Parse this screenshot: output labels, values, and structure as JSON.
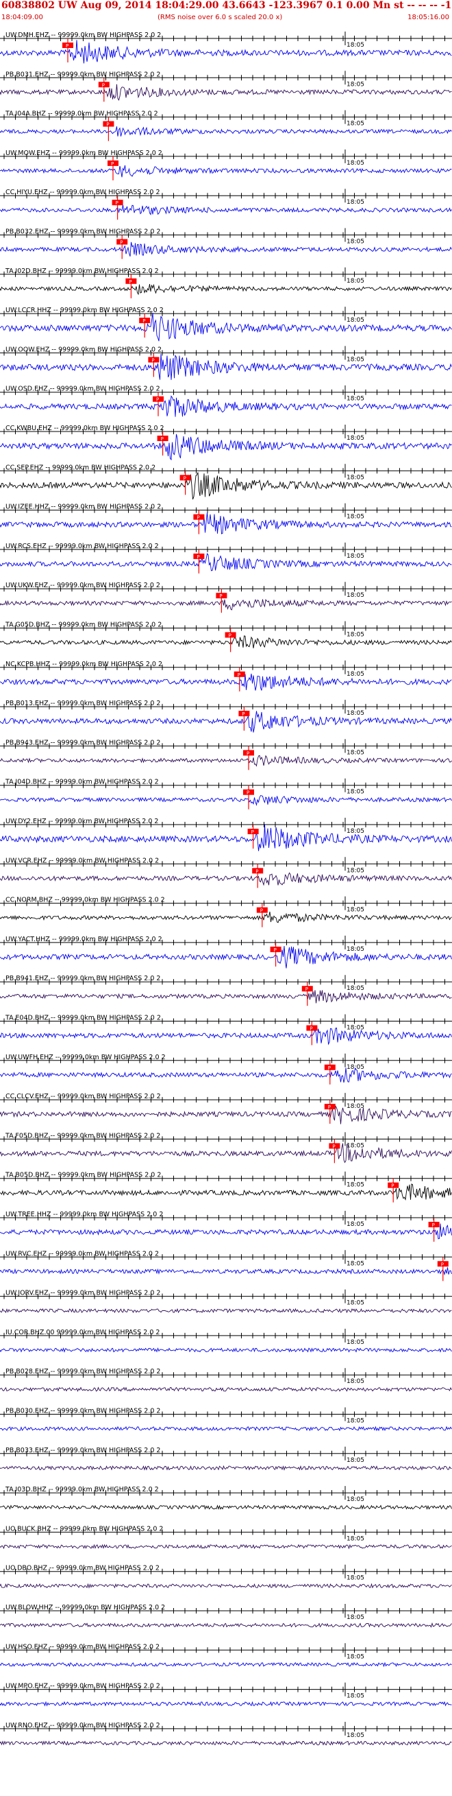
{
  "header": {
    "title": "60838802 UW Aug 09, 2014 18:04:29.00   43.6643 -123.3967  0.1 0.00 Mn st -- -- --  -1",
    "time_start": "18:04:09.00",
    "note": "(RMS noise over 6.0 s scaled 20.0 x)",
    "time_end": "18:05:16.00"
  },
  "minute_label": "18:05",
  "pick_label": "P",
  "colors": {
    "header": "#d00000",
    "pick": "#ff0000",
    "blue": "#0000ee",
    "black": "#000000",
    "purple": "#2a0a55",
    "axis": "#000000"
  },
  "traces": [
    {
      "label": "UW.DMH.EHZ -- 99999.0km BW  HIGHPASS  2.0  2",
      "color": "blue",
      "pick": 0.15,
      "amp": 0.8
    },
    {
      "label": "PB.B031.EHZ -- 99999.0km BW  HIGHPASS  2.0  2",
      "color": "purple",
      "pick": 0.23,
      "amp": 0.5
    },
    {
      "label": "TA.I04A.BHZ -- 99999.0km BW  HIGHPASS  2.0  2",
      "color": "blue",
      "pick": 0.24,
      "amp": 0.3
    },
    {
      "label": "UW.MOW.EHZ -- 99999.0km BW  HIGHPASS  2.0  2",
      "color": "blue",
      "pick": 0.25,
      "amp": 0.35
    },
    {
      "label": "CC.HIYU.EHZ -- 99999.0km BW  HIGHPASS  2.0  2",
      "color": "blue",
      "pick": 0.26,
      "amp": 0.35
    },
    {
      "label": "PB.B032.EHZ -- 99999.0km BW  HIGHPASS  2.0  2",
      "color": "blue",
      "pick": 0.27,
      "amp": 0.4
    },
    {
      "label": "TA.I02D.BHZ -- 99999.0km BW  HIGHPASS  2.0  2",
      "color": "black",
      "pick": 0.29,
      "amp": 0.3
    },
    {
      "label": "UW.LCCR.HHZ -- 99999.0km BW  HIGHPASS  2.0  2",
      "color": "blue",
      "pick": 0.32,
      "amp": 1.0
    },
    {
      "label": "UW.OOW.EHZ -- 99999.0km BW  HIGHPASS  2.0  2",
      "color": "blue",
      "pick": 0.34,
      "amp": 1.0
    },
    {
      "label": "UW.OSD.EHZ -- 99999.0km BW  HIGHPASS  2.0  2",
      "color": "blue",
      "pick": 0.35,
      "amp": 0.8
    },
    {
      "label": "CC.KWBU.EHZ -- 99999.0km BW  HIGHPASS  2.0  2",
      "color": "blue",
      "pick": 0.36,
      "amp": 0.9
    },
    {
      "label": "CC.SEP.EHZ -- 99999.0km BW  HIGHPASS  2.0  2",
      "color": "black",
      "pick": 0.41,
      "amp": 0.9
    },
    {
      "label": "UW.IZEE.HHZ -- 99999.0km BW  HIGHPASS  2.0  2",
      "color": "blue",
      "pick": 0.44,
      "amp": 0.7
    },
    {
      "label": "UW.RCS.EHZ -- 99999.0km BW  HIGHPASS  2.0  2",
      "color": "blue",
      "pick": 0.44,
      "amp": 0.6
    },
    {
      "label": "UW.UKW.EHZ -- 99999.0km BW  HIGHPASS  2.0  2",
      "color": "purple",
      "pick": 0.49,
      "amp": 0.4
    },
    {
      "label": "TA.G05D.BHZ -- 99999.0km BW  HIGHPASS  2.0  2",
      "color": "black",
      "pick": 0.51,
      "amp": 0.4
    },
    {
      "label": "NC.KCPB.HHZ -- 99999.0km BW  HIGHPASS  2.0  2",
      "color": "blue",
      "pick": 0.53,
      "amp": 0.7
    },
    {
      "label": "PB.B013.EHZ -- 99999.0km BW  HIGHPASS  2.0  2",
      "color": "blue",
      "pick": 0.54,
      "amp": 0.7
    },
    {
      "label": "PB.B943.EHZ -- 99999.0km BW  HIGHPASS  2.0  2",
      "color": "purple",
      "pick": 0.55,
      "amp": 0.3
    },
    {
      "label": "TA.J04D.BHZ -- 99999.0km BW  HIGHPASS  2.0  2",
      "color": "blue",
      "pick": 0.55,
      "amp": 0.3
    },
    {
      "label": "UW.DY2.EHZ -- 99999.0km BW  HIGHPASS  2.0  2",
      "color": "blue",
      "pick": 0.56,
      "amp": 1.0
    },
    {
      "label": "UW.VCR.EHZ -- 99999.0km BW  HIGHPASS  2.0  2",
      "color": "purple",
      "pick": 0.57,
      "amp": 0.5
    },
    {
      "label": "CC.NORM.BHZ -- 99999.0km BW  HIGHPASS  2.0  2",
      "color": "black",
      "pick": 0.58,
      "amp": 0.35
    },
    {
      "label": "UW.YACT.HHZ -- 99999.0km BW  HIGHPASS  2.0  2",
      "color": "blue",
      "pick": 0.61,
      "amp": 0.7
    },
    {
      "label": "PB.B941.EHZ -- 99999.0km BW  HIGHPASS  2.0  2",
      "color": "purple",
      "pick": 0.68,
      "amp": 0.4
    },
    {
      "label": "TA.E04D.BHZ -- 99999.0km BW  HIGHPASS  2.0  2",
      "color": "blue",
      "pick": 0.69,
      "amp": 0.6
    },
    {
      "label": "UW.UWFH.EHZ -- 99999.0km BW  HIGHPASS  2.0  2",
      "color": "blue",
      "pick": 0.73,
      "amp": 0.5
    },
    {
      "label": "CC.CLCV.EHZ -- 99999.0km BW  HIGHPASS  2.0  2",
      "color": "purple",
      "pick": 0.73,
      "amp": 0.6
    },
    {
      "label": "TA.F05D.BHZ -- 99999.0km BW  HIGHPASS  2.0  2",
      "color": "purple",
      "pick": 0.74,
      "amp": 0.6
    },
    {
      "label": "TA.B05D.BHZ -- 99999.0km BW  HIGHPASS  2.0  2",
      "color": "black",
      "pick": 0.87,
      "amp": 0.6
    },
    {
      "label": "UW.TREE.HHZ -- 99999.0km BW  HIGHPASS  2.0  2",
      "color": "blue",
      "pick": 0.96,
      "amp": 0.6
    },
    {
      "label": "UW.RVC.EHZ -- 99999.0km BW  HIGHPASS  2.0  2",
      "color": "blue",
      "pick": 0.98,
      "amp": 0.4
    },
    {
      "label": "UW.JORV.EHZ -- 99999.0km BW  HIGHPASS  2.0  2",
      "color": "purple",
      "pick": null,
      "amp": 0.25
    },
    {
      "label": "IU.COR.BHZ.00 99999.0km BW  HIGHPASS  2.0  2",
      "color": "blue",
      "pick": null,
      "amp": 0.25
    },
    {
      "label": "PB.B028.EHZ -- 99999.0km BW  HIGHPASS  2.0  2",
      "color": "purple",
      "pick": null,
      "amp": 0.25
    },
    {
      "label": "PB.B030.EHZ -- 99999.0km BW  HIGHPASS  2.0  2",
      "color": "blue",
      "pick": null,
      "amp": 0.25
    },
    {
      "label": "PB.B033.EHZ -- 99999.0km BW  HIGHPASS  2.0  2",
      "color": "purple",
      "pick": null,
      "amp": 0.25
    },
    {
      "label": "TA.I03D.BHZ -- 99999.0km BW  HIGHPASS  2.0  2",
      "color": "black",
      "pick": null,
      "amp": 0.25
    },
    {
      "label": "UO.BUCK.BHZ -- 99999.0km BW  HIGHPASS  2.0  2",
      "color": "purple",
      "pick": null,
      "amp": 0.25
    },
    {
      "label": "UO.DBO.BHZ -- 99999.0km BW  HIGHPASS  2.0  2",
      "color": "purple",
      "pick": null,
      "amp": 0.25
    },
    {
      "label": "UW.BLOW.HHZ -- 99999.0km BW  HIGHPASS  2.0  2",
      "color": "purple",
      "pick": null,
      "amp": 0.25
    },
    {
      "label": "UW.HSO.EHZ -- 99999.0km BW  HIGHPASS  2.0  2",
      "color": "blue",
      "pick": null,
      "amp": 0.2
    },
    {
      "label": "UW.MPO.EHZ -- 99999.0km BW  HIGHPASS  2.0  2",
      "color": "blue",
      "pick": null,
      "amp": 0.25
    },
    {
      "label": "UW.RNO.EHZ -- 99999.0km BW  HIGHPASS  2.0  2",
      "color": "purple",
      "pick": null,
      "amp": 0.25
    }
  ]
}
